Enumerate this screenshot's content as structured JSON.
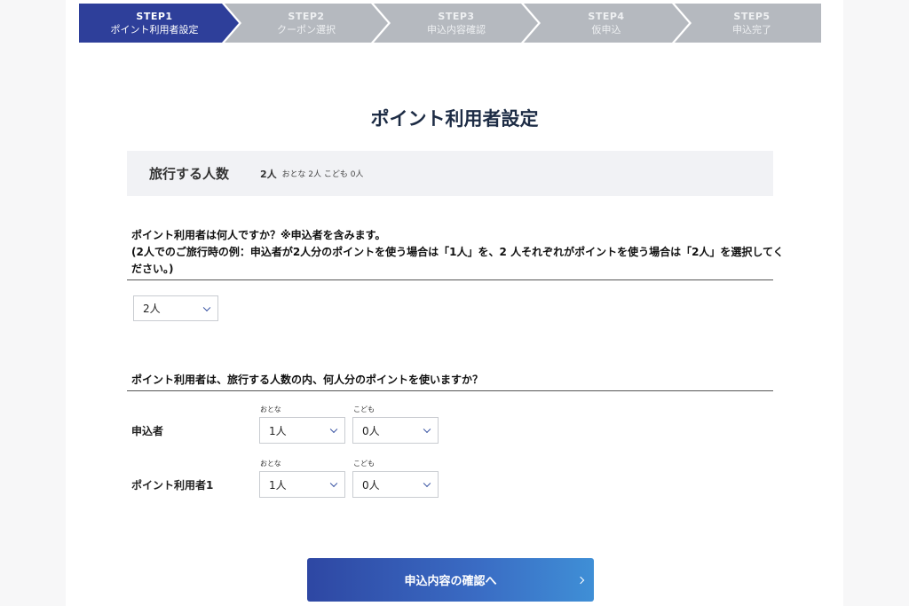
{
  "steps": [
    {
      "num": "STEP1",
      "name": "ポイント利用者設定",
      "active": true
    },
    {
      "num": "STEP2",
      "name": "クーポン選択",
      "active": false
    },
    {
      "num": "STEP3",
      "name": "申込内容確認",
      "active": false
    },
    {
      "num": "STEP4",
      "name": "仮申込",
      "active": false
    },
    {
      "num": "STEP5",
      "name": "申込完了",
      "active": false
    }
  ],
  "colors": {
    "active_step": "#2e3f9a",
    "inactive_step": "#b5b9bf",
    "accent": "#2e4a9e"
  },
  "page_title": "ポイント利用者設定",
  "party": {
    "label": "旅行する人数",
    "total": "2人",
    "detail": "おとな 2人 こども 0人"
  },
  "question1": {
    "line1": "ポイント利用者は何人ですか？※申込者を含みます。",
    "line2": "(2人でのご旅行時の例：申込者が2人分のポイントを使う場合は「1人」を、2 人それぞれがポイントを使う場合は「2人」を選択してく",
    "line3": "ださい。)",
    "select_value": "2人"
  },
  "question2": {
    "text": "ポイント利用者は、旅行する人数の内、何人分のポイントを使いますか？",
    "adult_label": "おとな",
    "child_label": "こども",
    "rows": [
      {
        "label": "申込者",
        "adult": "1人",
        "child": "0人"
      },
      {
        "label": "ポイント利用者1",
        "adult": "1人",
        "child": "0人"
      }
    ]
  },
  "confirm_button": "申込内容の確認へ",
  "icons": {
    "dropdown": "chevron-down-icon",
    "button_arrow": "chevron-right-icon"
  }
}
